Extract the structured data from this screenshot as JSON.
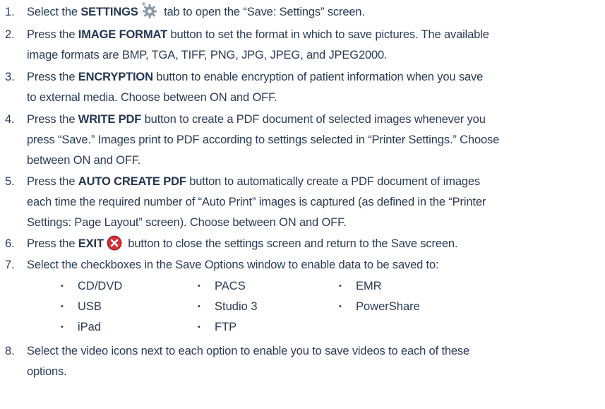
{
  "steps": [
    {
      "num": "1.",
      "pre": "Select the ",
      "bold": "SETTINGS",
      "post": " tab to open the “Save: Settings” screen.",
      "icon": "gear-icon"
    },
    {
      "num": "2.",
      "pre": "Press the ",
      "bold": "IMAGE FORMAT",
      "post": " button to set the format in which to save pictures. The available",
      "line2": "image formats are BMP, TGA, TIFF, PNG, JPG, JPEG, and JPEG2000."
    },
    {
      "num": "3.",
      "pre": "Press the ",
      "bold": "ENCRYPTION",
      "post": " button to enable encryption of patient information when you save",
      "line2": "to external media. Choose between ON and OFF."
    },
    {
      "num": "4.",
      "pre": "Press the ",
      "bold": "WRITE PDF",
      "post": " button to create a PDF document of selected images whenever you",
      "line2": "press “Save.” Images print to PDF according to settings selected in “Printer Settings.” Choose",
      "line3": "between ON and OFF."
    },
    {
      "num": "5.",
      "pre": "Press the ",
      "bold": "AUTO CREATE PDF",
      "post": " button to automatically create a PDF document of images",
      "line2": "each time the required number of “Auto Print” images is captured (as defined in the “Printer",
      "line3": "Settings: Page Layout” screen). Choose between ON and OFF."
    },
    {
      "num": "6.",
      "pre": "Press the ",
      "bold": "EXIT",
      "post": " button to close the settings screen and return to the Save screen.",
      "icon": "close-icon"
    },
    {
      "num": "7.",
      "line1": "Select the checkboxes in the Save Options window to enable data to be saved to:"
    },
    {
      "num": "8.",
      "line1": "Select the video icons next to each option to enable you to save videos to each of these",
      "line2": "options."
    }
  ],
  "options": [
    "CD/DVD",
    "PACS",
    "EMR",
    "USB",
    "Studio 3",
    "PowerShare",
    "iPad",
    "FTP"
  ],
  "bullet": "•",
  "colors": {
    "text": "#2b3b54",
    "exit_red": "#d0343a",
    "gear_gray": "#8b9aa8"
  }
}
